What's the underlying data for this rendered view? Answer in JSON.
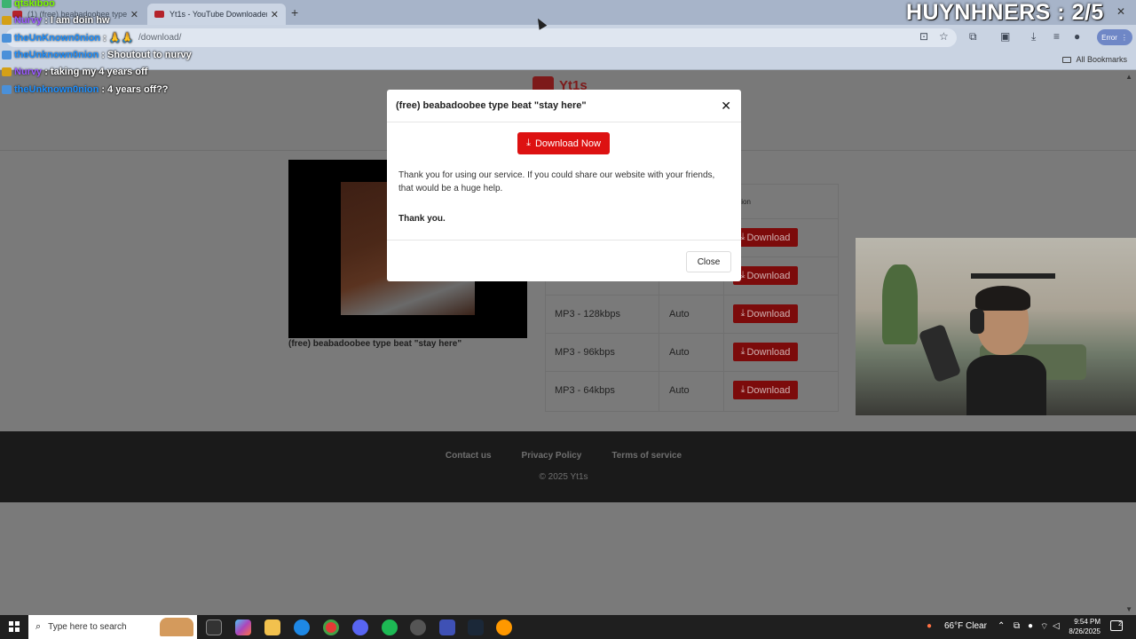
{
  "browser": {
    "tabs": [
      {
        "title": "(1) (free) beabadoobee type be",
        "active": false
      },
      {
        "title": "Yt1s - YouTube Downloader | Yo",
        "active": true
      }
    ],
    "new_tab_icon": "plus-icon",
    "url": "/download/",
    "error_label": "Error",
    "all_bookmarks": "All Bookmarks"
  },
  "site": {
    "logo_text": "Yt1s",
    "video_title": "(free) beabadoobee type beat \"stay here\"",
    "table": {
      "action_header": "ction",
      "rows": [
        {
          "format": "",
          "size": "",
          "button": "Download"
        },
        {
          "format": "",
          "size": "",
          "button": "Download"
        },
        {
          "format": "MP3 - 128kbps",
          "size": "Auto",
          "button": "Download"
        },
        {
          "format": "MP3 - 96kbps",
          "size": "Auto",
          "button": "Download"
        },
        {
          "format": "MP3 - 64kbps",
          "size": "Auto",
          "button": "Download"
        }
      ]
    },
    "footer": {
      "links": [
        "Contact us",
        "Privacy Policy",
        "Terms of service"
      ],
      "copyright": "© 2025 Yt1s"
    }
  },
  "modal": {
    "title": "(free) beabadoobee type beat \"stay here\"",
    "download_now": "Download Now",
    "message": "Thank you for using our service. If you could share our website with your friends, that would be a huge help.",
    "thanks": "Thank you.",
    "close": "Close"
  },
  "overlay": {
    "counter": "HUYNHNERS : 2/5",
    "chat": [
      {
        "user": "qtskiboo",
        "msg": "",
        "user_color": "#7CFC00"
      },
      {
        "user": "Nurvy",
        "msg": ": I am doin hw",
        "user_color": "#9b59ff"
      },
      {
        "user": "theUnKnown0nion",
        "msg": ": 🙏🙏",
        "user_color": "#1e90ff"
      },
      {
        "user": "theUnknown0nion",
        "msg": ": Shoutout to nurvy",
        "user_color": "#1e90ff"
      },
      {
        "user": "Nurvy",
        "msg": ": taking my 4 years off",
        "user_color": "#9b59ff"
      },
      {
        "user": "theUnknown0nion",
        "msg": ": 4 years off??",
        "user_color": "#1e90ff"
      }
    ]
  },
  "taskbar": {
    "search_placeholder": "Type here to search",
    "weather": "66°F  Clear",
    "time": "9:54 PM",
    "date": "8/26/2025",
    "notifications": "2"
  },
  "colors": {
    "accent_red": "#dd1111",
    "chrome_blue": "#c9d3e2",
    "footer_bg": "#1a1a1a"
  }
}
